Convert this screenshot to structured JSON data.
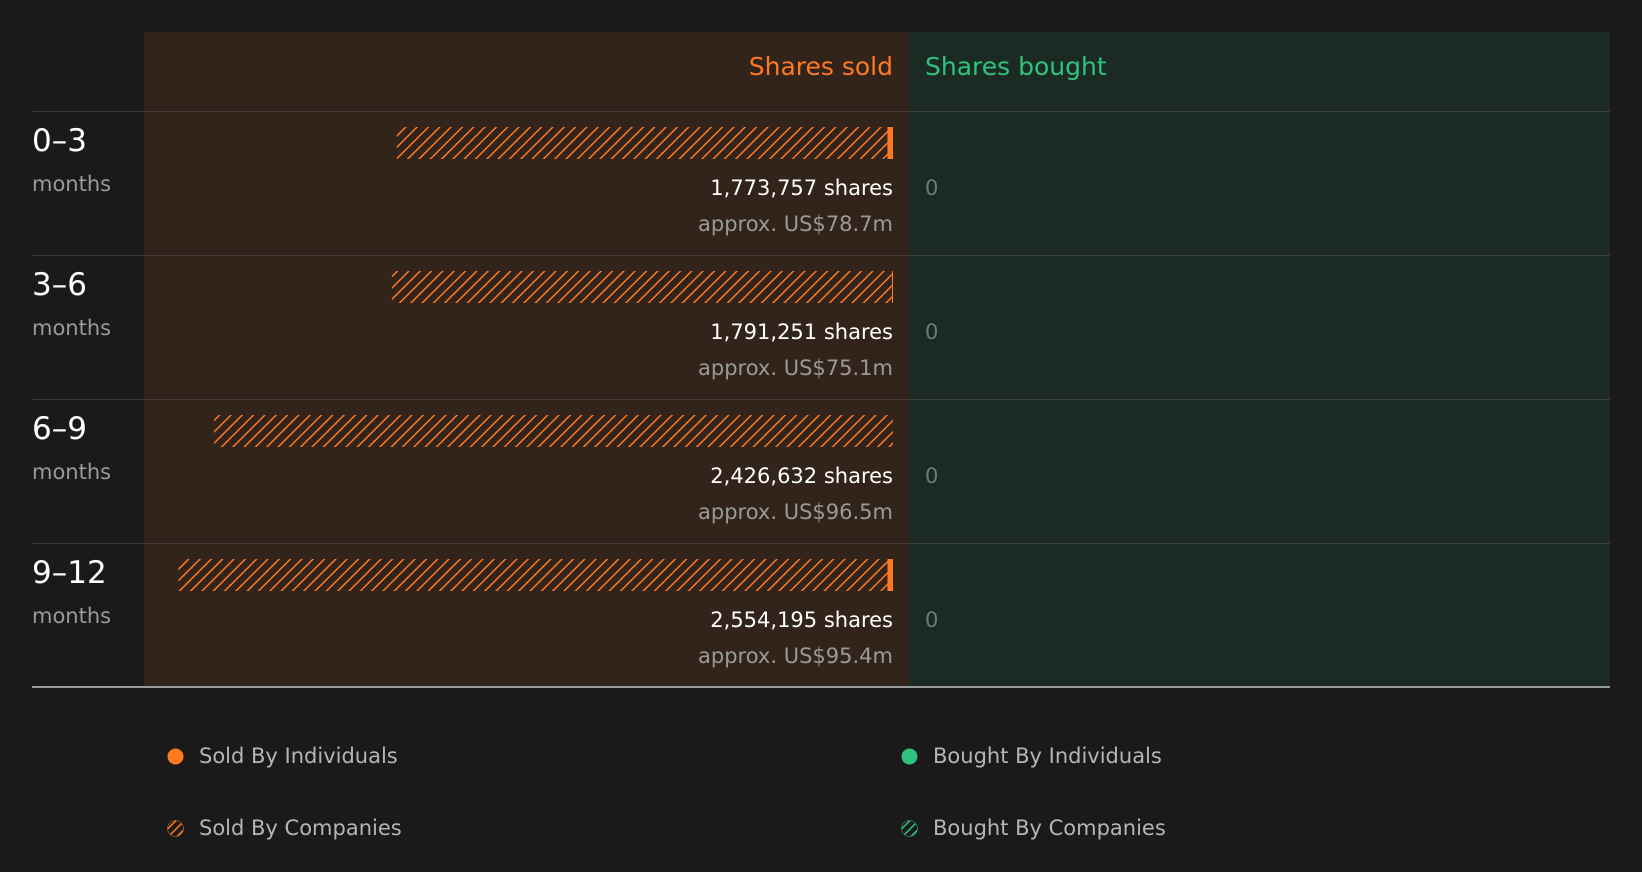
{
  "colors": {
    "sold": "#ff7a1f",
    "bought": "#2ec27e"
  },
  "header": {
    "sold_label": "Shares sold",
    "bought_label": "Shares bought"
  },
  "legend": {
    "sold_individuals": "Sold By Individuals",
    "sold_companies": "Sold By Companies",
    "bought_individuals": "Bought By Individuals",
    "bought_companies": "Bought By Companies"
  },
  "rows": [
    {
      "period": "0–3",
      "unit": "months",
      "shares_text": "1,773,757 shares",
      "approx_text": "approx. US$78.7m",
      "bought_text": "0"
    },
    {
      "period": "3–6",
      "unit": "months",
      "shares_text": "1,791,251 shares",
      "approx_text": "approx. US$75.1m",
      "bought_text": "0"
    },
    {
      "period": "6–9",
      "unit": "months",
      "shares_text": "2,426,632 shares",
      "approx_text": "approx. US$96.5m",
      "bought_text": "0"
    },
    {
      "period": "9–12",
      "unit": "months",
      "shares_text": "2,554,195 shares",
      "approx_text": "approx. US$95.4m",
      "bought_text": "0"
    }
  ],
  "chart_data": {
    "type": "bar",
    "categories": [
      "0–3 months",
      "3–6 months",
      "6–9 months",
      "9–12 months"
    ],
    "series": [
      {
        "name": "Sold By Individuals",
        "values": [
          20000,
          4000,
          0,
          20000
        ]
      },
      {
        "name": "Sold By Companies",
        "values": [
          1753757,
          1787251,
          2426632,
          2534195
        ]
      },
      {
        "name": "Bought By Individuals",
        "values": [
          0,
          0,
          0,
          0
        ]
      },
      {
        "name": "Bought By Companies",
        "values": [
          0,
          0,
          0,
          0
        ]
      }
    ],
    "totals_sold": [
      1773757,
      1791251,
      2426632,
      2554195
    ],
    "totals_bought": [
      0,
      0,
      0,
      0
    ],
    "value_usd_millions": [
      78.7,
      75.1,
      96.5,
      95.4
    ],
    "xlim": [
      0,
      2620000
    ]
  }
}
